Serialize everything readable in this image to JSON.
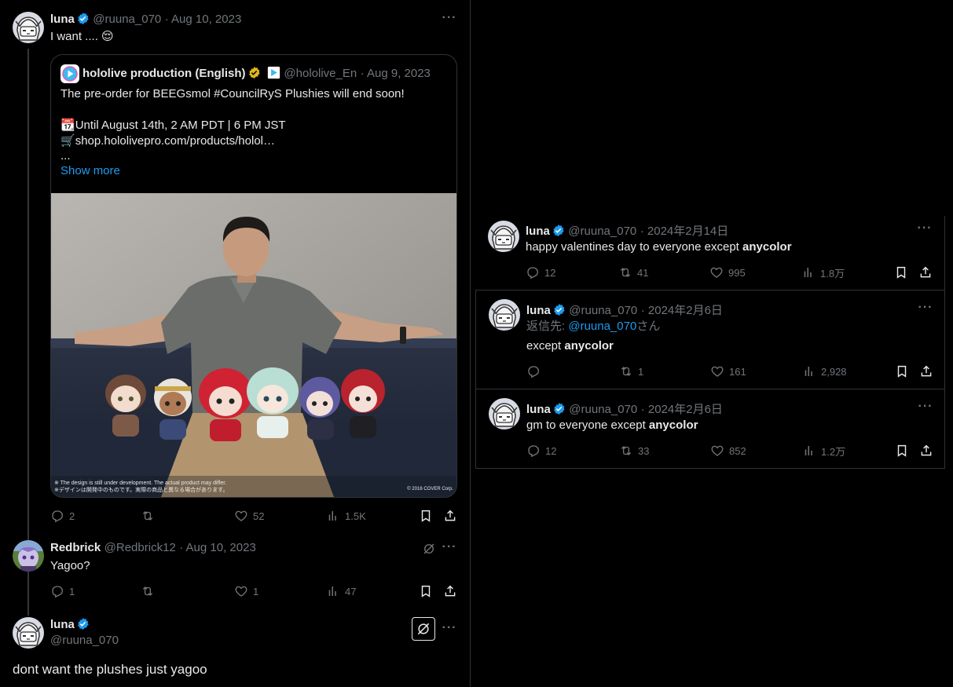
{
  "main_tweet": {
    "name": "luna",
    "handle": "@ruuna_070",
    "date": "· Aug 10, 2023",
    "text": "I want .... ",
    "emoji": "😌",
    "actions": {
      "replies": "2",
      "retweets": "",
      "likes": "52",
      "views": "1.5K"
    }
  },
  "quote": {
    "name": "hololive production (English)",
    "handle": "@hololive_En",
    "date": "· Aug 9, 2023",
    "line1": "The pre-order for BEEGsmol #CouncilRyS Plushies will end soon!",
    "line2_emoji": "📆",
    "line2": "Until August 14th, 2 AM PDT | 6 PM JST",
    "line3_emoji": "🛒",
    "line3": "shop.hololivepro.com/products/holol…",
    "ellipsis": "...",
    "show_more": "Show more",
    "image_caption_left": "※ The design is still under development. The actual product may differ.\n※デザインは開発中のものです。実際の商品と異なる場合があります。",
    "image_caption_right": "© 2016 COVER Corp."
  },
  "reply": {
    "name": "Redbrick",
    "handle": "@Redbrick12",
    "date": "· Aug 10, 2023",
    "text": "Yagoo?",
    "actions": {
      "replies": "1",
      "retweets": "",
      "likes": "1",
      "views": "47"
    }
  },
  "focused_tweet": {
    "name": "luna",
    "handle": "@ruuna_070",
    "text": "dont want the plushes just yagoo"
  },
  "right_tweets": [
    {
      "name": "luna",
      "handle": "@ruuna_070",
      "date": "· 2024年2月14日",
      "text_pre": "happy valentines day to everyone except ",
      "text_bold": "anycolor",
      "replies": "12",
      "retweets": "41",
      "likes": "995",
      "views": "1.8万"
    },
    {
      "name": "luna",
      "handle": "@ruuna_070",
      "date": "· 2024年2月6日",
      "reply_to_prefix": "返信先: ",
      "reply_to_handle": "@ruuna_070",
      "reply_to_suffix": "さん",
      "text_pre": "except ",
      "text_bold": "anycolor",
      "replies": "",
      "retweets": "1",
      "likes": "161",
      "views": "2,928"
    },
    {
      "name": "luna",
      "handle": "@ruuna_070",
      "date": "· 2024年2月6日",
      "text_pre": "gm to everyone except ",
      "text_bold": "anycolor",
      "replies": "12",
      "retweets": "33",
      "likes": "852",
      "views": "1.2万"
    }
  ],
  "colors": {
    "accent": "#1d9bf0",
    "muted": "#71767b",
    "text": "#e7e9ea",
    "border": "#2f3336",
    "gold": "#e2b719"
  }
}
